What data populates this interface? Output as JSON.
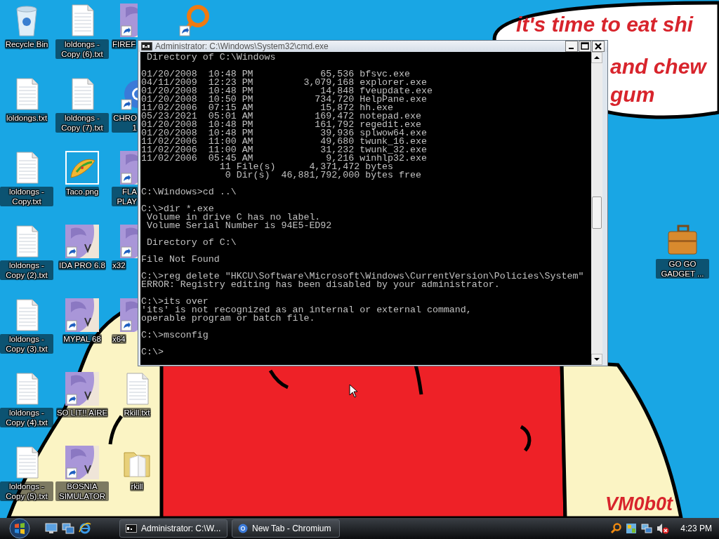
{
  "desktop_columns": [
    {
      "items": [
        {
          "label": "Recycle Bin",
          "kind": "recycle-bin",
          "shortcut": false
        },
        {
          "label": "loldongs.txt",
          "kind": "text-file",
          "shortcut": false
        },
        {
          "label": "loldongs - Copy.txt",
          "kind": "text-file",
          "shortcut": false
        },
        {
          "label": "loldongs - Copy (2).txt",
          "kind": "text-file",
          "shortcut": false
        },
        {
          "label": "loldongs - Copy (3).txt",
          "kind": "text-file",
          "shortcut": false
        },
        {
          "label": "loldongs - Copy (4).txt",
          "kind": "text-file",
          "shortcut": false
        },
        {
          "label": "loldongs - Copy (5).txt",
          "kind": "text-file",
          "shortcut": false
        }
      ]
    },
    {
      "items": [
        {
          "label": "loldongs - Copy (6).txt",
          "kind": "text-file",
          "shortcut": false
        },
        {
          "label": "loldongs - Copy (7).txt",
          "kind": "text-file",
          "shortcut": false
        },
        {
          "label": "Taco.png",
          "kind": "taco",
          "shortcut": false
        },
        {
          "label": "IDA PRO 6.8",
          "kind": "picture",
          "shortcut": true
        },
        {
          "label": "MYPAL 68",
          "kind": "picture",
          "shortcut": true
        },
        {
          "label": "SO LIT!! AIRE",
          "kind": "picture",
          "shortcut": true
        },
        {
          "label": "BOSNIA SIMULATOR",
          "kind": "picture",
          "shortcut": true
        }
      ]
    },
    {
      "items": [
        {
          "label": "FIREF",
          "kind": "picture",
          "shortcut": true,
          "covered": true
        },
        {
          "label": "CHRO 1",
          "kind": "browser",
          "shortcut": true,
          "covered": true
        },
        {
          "label": "FLA PLAY",
          "kind": "picture",
          "shortcut": true,
          "covered": true
        },
        {
          "label": "x32",
          "kind": "picture",
          "shortcut": true,
          "covered": true
        },
        {
          "label": "x64",
          "kind": "picture",
          "shortcut": true,
          "covered": true
        },
        {
          "label": "Rkill.txt",
          "kind": "text-file",
          "shortcut": false,
          "covered": false
        },
        {
          "label": "rkill",
          "kind": "folder",
          "shortcut": false,
          "covered": false
        }
      ]
    },
    {
      "items": [
        {
          "kind": "ring",
          "shortcut": true
        }
      ]
    }
  ],
  "right_icons": [
    {
      "label": "GO GO GADGET ...",
      "kind": "briefcase",
      "shortcut": false
    }
  ],
  "wallpaper": {
    "bubble_lines": [
      "it's time to eat shi",
      "and chew",
      "gum"
    ],
    "signature": "VM0b0t"
  },
  "console_window": {
    "title": "Administrator: C:\\Windows\\System32\\cmd.exe",
    "blocks": [
      [
        " Directory of C:\\Windows"
      ],
      [
        "01/20/2008  10:48 PM            65,536 bfsvc.exe",
        "04/11/2009  12:23 PM         3,079,168 explorer.exe",
        "01/20/2008  10:48 PM            14,848 fveupdate.exe",
        "01/20/2008  10:50 PM           734,720 HelpPane.exe",
        "11/02/2006  07:15 AM            15,872 hh.exe",
        "05/23/2021  05:01 AM           169,472 notepad.exe",
        "01/20/2008  10:48 PM           161,792 regedit.exe",
        "01/20/2008  10:48 PM            39,936 splwow64.exe",
        "11/02/2006  11:00 AM            49,680 twunk_16.exe",
        "11/02/2006  11:00 AM            31,232 twunk_32.exe",
        "11/02/2006  05:45 AM             9,216 winhlp32.exe",
        "              11 File(s)      4,371,472 bytes",
        "               0 Dir(s)  46,881,792,000 bytes free"
      ],
      [
        "C:\\Windows>cd ..\\"
      ],
      [
        "C:\\>dir *.exe",
        " Volume in drive C has no label.",
        " Volume Serial Number is 94E5-ED92"
      ],
      [
        " Directory of C:\\"
      ],
      [
        "File Not Found"
      ],
      [
        "C:\\>reg delete \"HKCU\\Software\\Microsoft\\Windows\\CurrentVersion\\Policies\\System\"",
        "ERROR: Registry editing has been disabled by your administrator."
      ],
      [
        "C:\\>its over",
        "'its' is not recognized as an internal or external command,",
        "operable program or batch file."
      ],
      [
        "C:\\>msconfig"
      ],
      [
        "C:\\>"
      ]
    ]
  },
  "taskbar": {
    "tasks": [
      {
        "label": "Administrator: C:\\W...",
        "kind": "console"
      },
      {
        "label": "New Tab - Chromium",
        "kind": "browser"
      }
    ],
    "clock": "4:23 PM"
  }
}
